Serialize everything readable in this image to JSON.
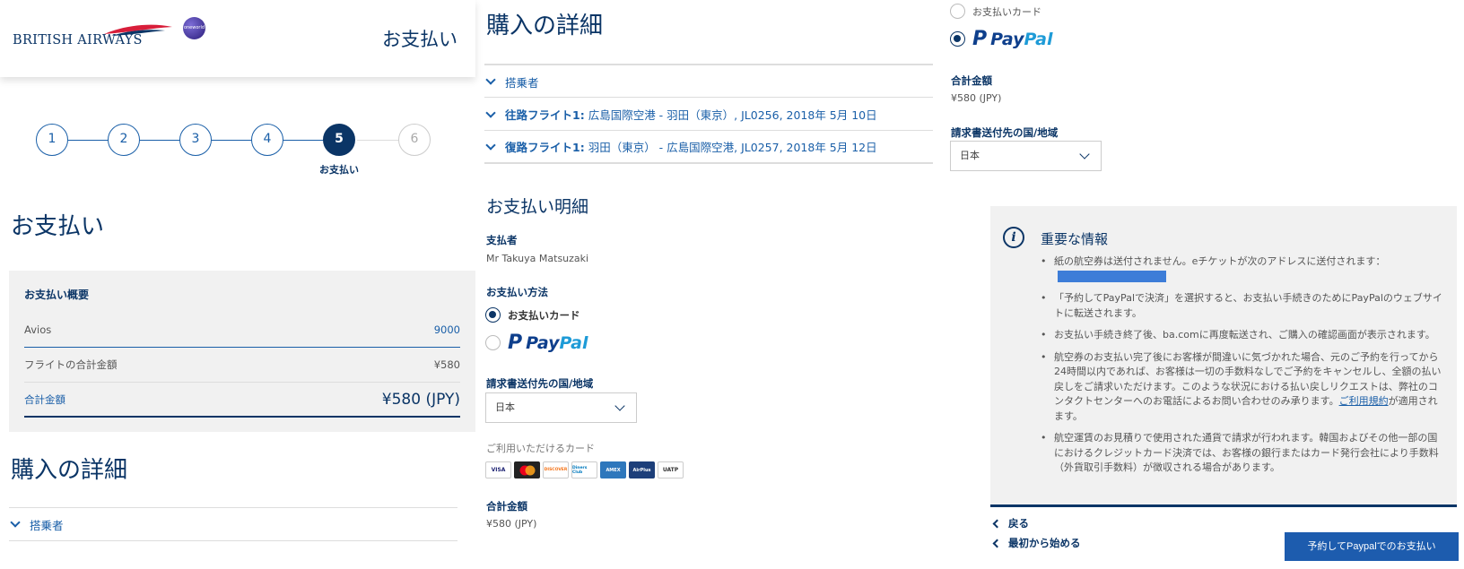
{
  "header": {
    "brand_text": "BRITISH AIRWAYS",
    "alliance_logo": "oneworld",
    "title": "お支払い"
  },
  "stepper": {
    "steps": [
      "1",
      "2",
      "3",
      "4",
      "5",
      "6"
    ],
    "active_caption": "お支払い"
  },
  "page": {
    "heading": "お支払い",
    "summary": {
      "title": "お支払い概要",
      "avios_label": "Avios",
      "avios_value": "9000",
      "flight_total_label": "フライトの合計金額",
      "flight_total_value": "¥580",
      "total_label": "合計金額",
      "total_value": "¥580 (JPY)"
    },
    "purchase_heading": "購入の詳細",
    "passenger_label": "搭乗者"
  },
  "details": {
    "heading": "購入の詳細",
    "passenger": "搭乗者",
    "outbound_prefix": "往路フライト1:",
    "outbound_text": "広島国際空港 - 羽田（東京）, JL0256, 2018年 5月 10日",
    "return_prefix": "復路フライト1:",
    "return_text": "羽田（東京） - 広島国際空港, JL0257, 2018年 5月 12日"
  },
  "payment": {
    "heading": "お支払い明細",
    "payer_label": "支払者",
    "payer_name": "Mr Takuya Matsuzaki",
    "method_label": "お支払い方法",
    "card_option": "お支払いカード",
    "paypal_p": "P",
    "paypal_pay": "Pay",
    "paypal_pal": "Pal",
    "billing_country_label": "請求書送付先の国/地域",
    "billing_country_value": "日本",
    "accepted_cards_label": "ご利用いただけるカード",
    "cards": [
      "VISA",
      "MC",
      "DISCOVER",
      "Diners Club",
      "AMEX",
      "AirPlus",
      "UATP"
    ],
    "total_label": "合計金額",
    "total_value": "¥580 (JPY)"
  },
  "payment_right": {
    "card_option": "お支払いカード",
    "total_label": "合計金額",
    "total_value": "¥580 (JPY)",
    "billing_country_label": "請求書送付先の国/地域",
    "billing_country_value": "日本"
  },
  "info": {
    "icon": "i",
    "title": "重要な情報",
    "item1": "紙の航空券は送付されません。eチケットが次のアドレスに送付されます：",
    "item2": "「予約してPayPalで決済」を選択すると、お支払い手続きのためにPayPalのウェブサイトに転送されます。",
    "item3": "お支払い手続き終了後、ba.comに再度転送され、ご購入の確認画面が表示されます。",
    "item4_text": "航空券のお支払い完了後にお客様が間違いに気づかれた場合、元のご予約を行ってから24時間以内であれば、お客様は一切の手数料なしでご予約をキャンセルし、全額の払い戻しをご請求いただけます。このような状況における払い戻しリクエストは、弊社のコンタクトセンターへのお電話によるお問い合わせのみ承ります。",
    "item4_link": "ご利用規約",
    "item4_tail": "が適用されます。",
    "item5": "航空運賃のお見積りで使用された通貨で請求が行われます。韓国およびその他一部の国におけるクレジットカード決済では、お客様の銀行またはカード発行会社により手数料（外貨取引手数料）が徴収される場合があります。"
  },
  "footer": {
    "back": "戻る",
    "restart": "最初から始める",
    "pay_button": "予約してPaypalでのお支払い"
  }
}
